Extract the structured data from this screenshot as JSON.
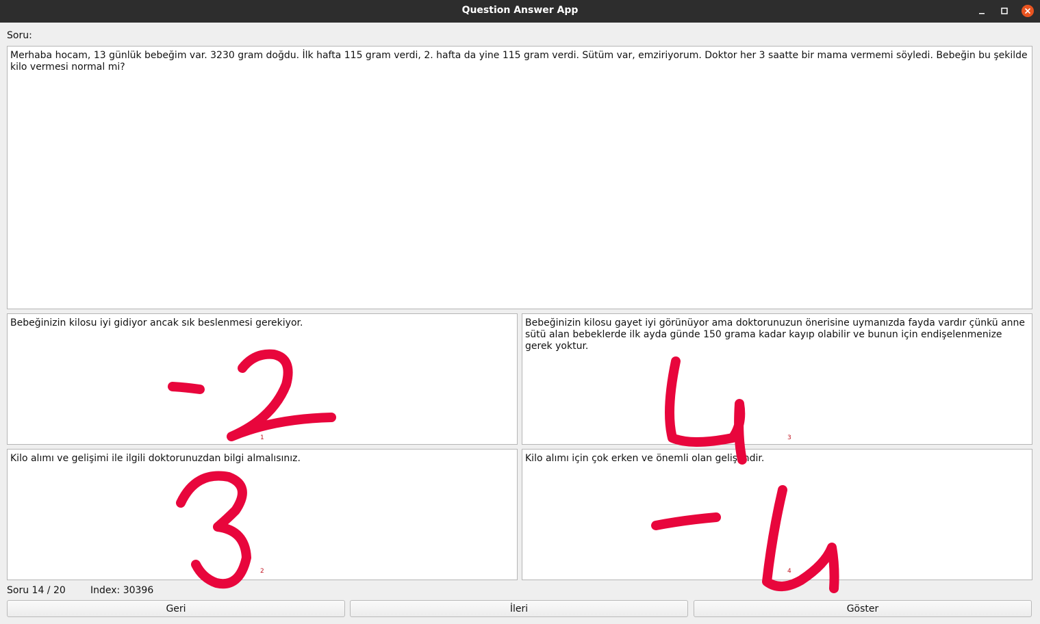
{
  "window": {
    "title": "Question Answer App"
  },
  "question": {
    "label": "Soru:",
    "text": "Merhaba hocam, 13 günlük bebeğim var. 3230 gram doğdu. İlk hafta 115 gram verdi, 2. hafta da yine 115 gram verdi. Sütüm var, emziriyorum. Doktor her 3 saatte bir mama vermemi söyledi. Bebeğin bu şekilde kilo vermesi normal mi?"
  },
  "answers": [
    {
      "index_label": "1",
      "text": "Bebeğinizin kilosu iyi gidiyor ancak sık beslenmesi gerekiyor.",
      "handwritten_score": "-2"
    },
    {
      "index_label": "3",
      "text": "Bebeğinizin kilosu gayet iyi görünüyor ama doktorunuzun önerisine uymanızda fayda vardır çünkü anne sütü alan bebeklerde ilk ayda günde 150 grama kadar kayıp olabilir ve bunun için endişelenmenize gerek yoktur.",
      "handwritten_score": "4"
    },
    {
      "index_label": "2",
      "text": "Kilo alımı ve gelişimi ile ilgili doktorunuzdan bilgi almalısınız.",
      "handwritten_score": "3"
    },
    {
      "index_label": "4",
      "text": "Kilo alımı için çok erken ve önemli olan gelişimdir.",
      "handwritten_score": "-4"
    }
  ],
  "status": {
    "count": "Soru 14 / 20",
    "index": "Index: 30396"
  },
  "buttons": {
    "back": "Geri",
    "next": "İleri",
    "show": "Göster"
  },
  "colors": {
    "titlebar": "#2d2d2d",
    "close_button": "#e95420",
    "ink": "#e8063c",
    "index_label": "#c1121f"
  }
}
